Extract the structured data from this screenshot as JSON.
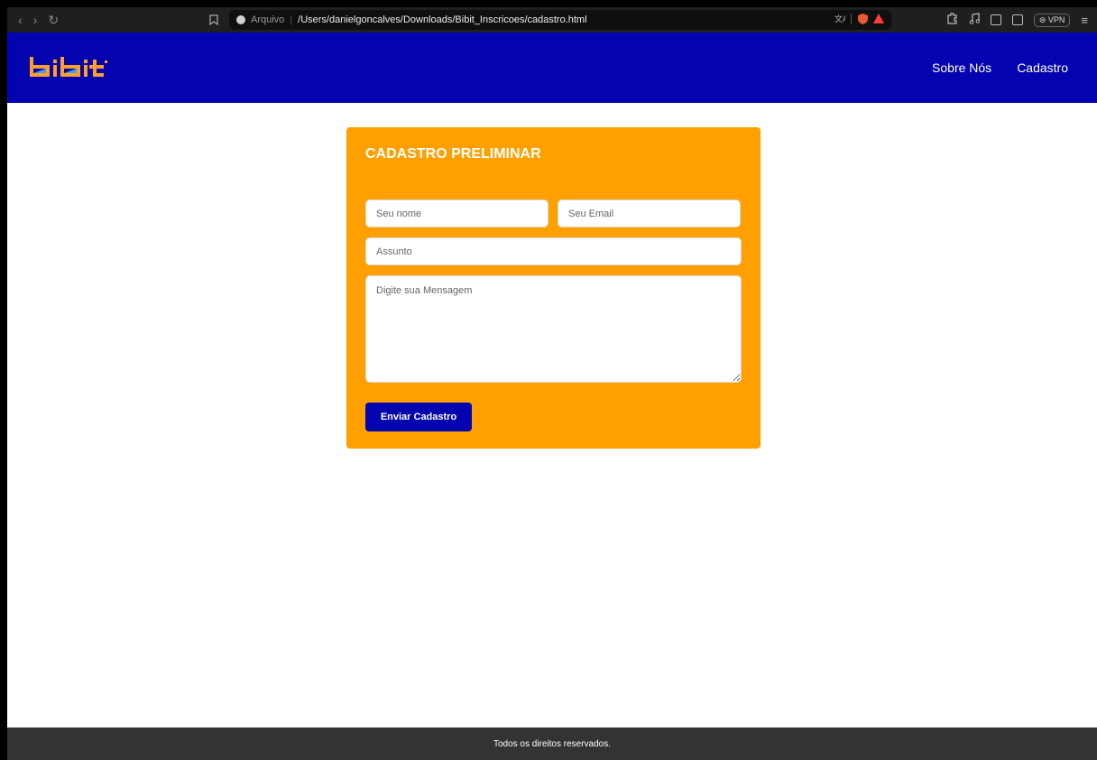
{
  "browser": {
    "nav": {
      "back": "‹",
      "forward": "›",
      "reload": "↻"
    },
    "url_scheme_label": "Arquivo",
    "url_separator": "|",
    "url_path": "/Users/danielgoncalves/Downloads/Bibit_Inscricoes/cadastro.html",
    "vpn_label": "VPN"
  },
  "header": {
    "logo_text": "bibit",
    "nav": [
      {
        "label": "Sobre Nós"
      },
      {
        "label": "Cadastro"
      }
    ],
    "bg_color": "#0303b0"
  },
  "form": {
    "title": "CADASTRO PRELIMINAR",
    "name_placeholder": "Seu nome",
    "email_placeholder": "Seu Email",
    "subject_placeholder": "Assunto",
    "message_placeholder": "Digite sua Mensagem",
    "submit_label": "Enviar Cadastro",
    "bg_color": "#ffa000"
  },
  "footer": {
    "text": "Todos os direitos reservados."
  }
}
